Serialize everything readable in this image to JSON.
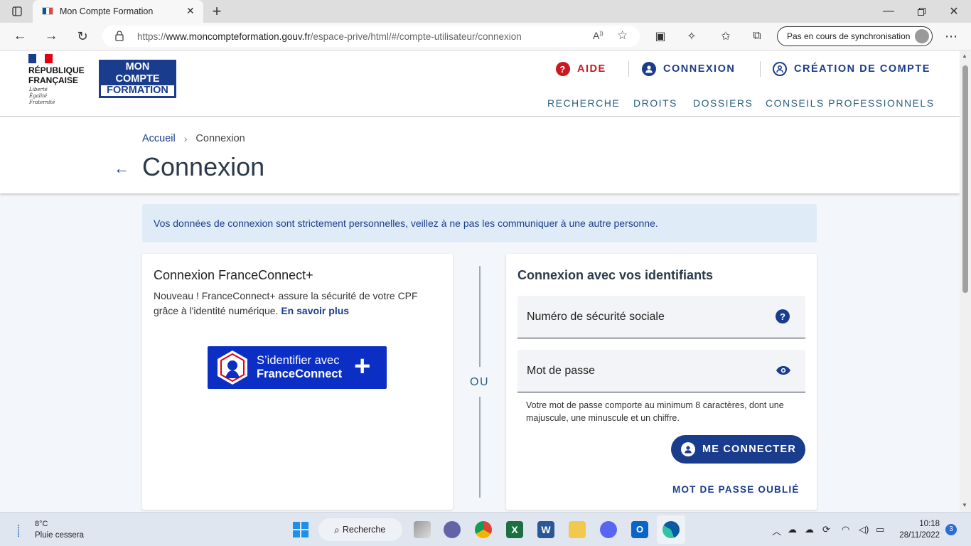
{
  "browser": {
    "tab_title": "Mon Compte Formation",
    "url_prefix": "https://",
    "url_host": "www.moncompteformation.gouv.fr",
    "url_path": "/espace-prive/html/#/compte-utilisateur/connexion",
    "sync_label": "Pas en cours de synchronisation"
  },
  "header": {
    "republique_line1": "RÉPUBLIQUE",
    "republique_line2": "FRANÇAISE",
    "motto_1": "Liberté",
    "motto_2": "Égalité",
    "motto_3": "Fraternité",
    "logo_line1": "MON",
    "logo_line2": "COMPTE",
    "logo_line3": "FORMATION",
    "top_links": [
      "AIDE",
      "CONNEXION",
      "CRÉATION DE COMPTE"
    ],
    "nav": [
      "RECHERCHE",
      "DROITS",
      "DOSSIERS",
      "CONSEILS PROFESSIONNELS"
    ]
  },
  "breadcrumb": {
    "home": "Accueil",
    "current": "Connexion"
  },
  "page_title": "Connexion",
  "info_banner": "Vos données de connexion sont strictement personnelles, veillez à ne pas les communiquer à une autre personne.",
  "franceconnect": {
    "title": "Connexion FranceConnect+",
    "desc": "Nouveau ! FranceConnect+ assure la sécurité de votre CPF grâce à l'identité numérique. ",
    "link": "En savoir plus",
    "btn_line1": "S’identifier avec",
    "btn_line2": "FranceConnect"
  },
  "divider_label": "OU",
  "login": {
    "title": "Connexion avec vos identifiants",
    "nss_label": "Numéro de sécurité sociale",
    "pwd_label": "Mot de passe",
    "pwd_hint": "Votre mot de passe comporte au minimum 8 caractères, dont une majuscule, une minuscule et un chiffre.",
    "submit": "ME CONNECTER",
    "forgot": "MOT DE PASSE OUBLIÉ"
  },
  "taskbar": {
    "temp": "8°C",
    "weather": "Pluie cessera",
    "search": "Recherche",
    "time": "10:18",
    "date": "28/11/2022",
    "notif_count": "3"
  },
  "colors": {
    "brand_blue": "#1a3c8c",
    "aide_red": "#c9191e",
    "nav_teal": "#2a5f7e",
    "info_bg": "#dfecf7",
    "fc_blue": "#0b2ec4"
  }
}
